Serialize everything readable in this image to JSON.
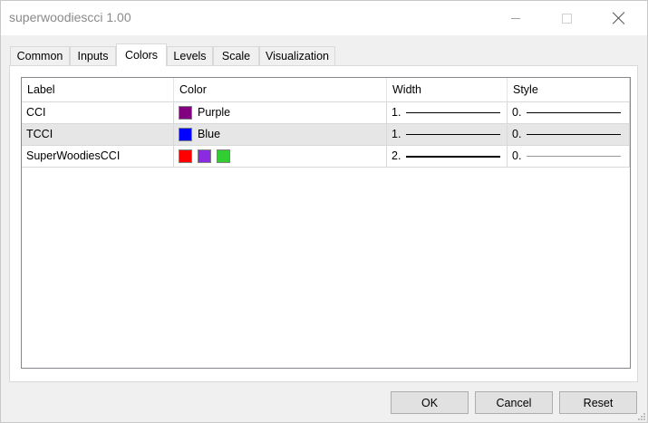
{
  "window": {
    "title": "superwoodiescci 1.00"
  },
  "tabs": [
    {
      "label": "Common"
    },
    {
      "label": "Inputs"
    },
    {
      "label": "Colors"
    },
    {
      "label": "Levels"
    },
    {
      "label": "Scale"
    },
    {
      "label": "Visualization"
    }
  ],
  "active_tab": "Colors",
  "table": {
    "headers": {
      "label": "Label",
      "color": "Color",
      "width": "Width",
      "style": "Style"
    },
    "rows": [
      {
        "label": "CCI",
        "swatches": [
          "#800080"
        ],
        "color_name": "Purple",
        "width": "1.",
        "style": "0."
      },
      {
        "label": "TCCI",
        "swatches": [
          "#0000ff"
        ],
        "color_name": "Blue",
        "width": "1.",
        "style": "0."
      },
      {
        "label": "SuperWoodiesCCI",
        "swatches": [
          "#ff0000",
          "#8a2be2",
          "#32cd32"
        ],
        "color_name": "",
        "width": "2.",
        "style": "0."
      }
    ]
  },
  "buttons": {
    "ok": "OK",
    "cancel": "Cancel",
    "reset": "Reset"
  },
  "colors": {
    "selected_row": "#e6e6e6",
    "window_bg": "#f0f0f0"
  },
  "icons": [
    "minimize-icon",
    "maximize-icon",
    "close-icon",
    "resize-grip-icon"
  ]
}
